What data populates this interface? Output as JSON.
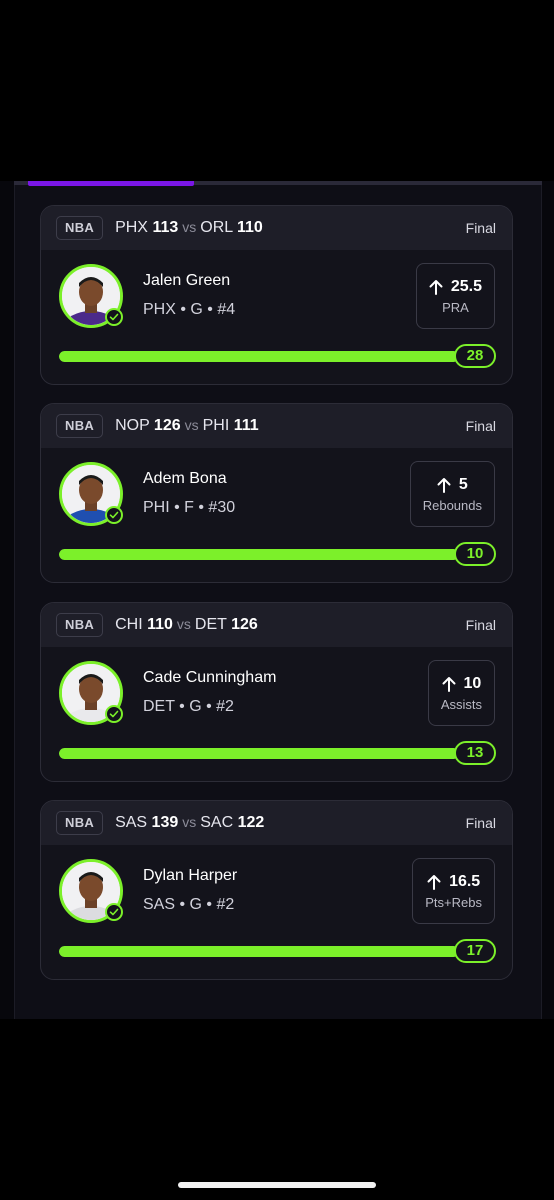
{
  "colors": {
    "accent": "#7cf02a",
    "tab_indicator": "#7a16e6",
    "card_bg": "#13131b",
    "header_bg": "#1e1e28"
  },
  "picks": [
    {
      "league": "NBA",
      "away_team": "PHX",
      "away_score": "113",
      "vs": "vs",
      "home_team": "ORL",
      "home_score": "110",
      "status": "Final",
      "player_name": "Jalen Green",
      "player_meta": "PHX • G • #4",
      "direction": "arrow-up-icon",
      "line_value": "25.5",
      "stat": "PRA",
      "result": "28",
      "progress": 1.0,
      "jersey_color": "#4b2a8a"
    },
    {
      "league": "NBA",
      "away_team": "NOP",
      "away_score": "126",
      "vs": "vs",
      "home_team": "PHI",
      "home_score": "111",
      "status": "Final",
      "player_name": "Adem Bona",
      "player_meta": "PHI • F • #30",
      "direction": "arrow-up-icon",
      "line_value": "5",
      "stat": "Rebounds",
      "result": "10",
      "progress": 1.0,
      "jersey_color": "#1f4fb0"
    },
    {
      "league": "NBA",
      "away_team": "CHI",
      "away_score": "110",
      "vs": "vs",
      "home_team": "DET",
      "home_score": "126",
      "status": "Final",
      "player_name": "Cade Cunningham",
      "player_meta": "DET • G • #2",
      "direction": "arrow-up-icon",
      "line_value": "10",
      "stat": "Assists",
      "result": "13",
      "progress": 1.0,
      "jersey_color": "#e9e9ec"
    },
    {
      "league": "NBA",
      "away_team": "SAS",
      "away_score": "139",
      "vs": "vs",
      "home_team": "SAC",
      "home_score": "122",
      "status": "Final",
      "player_name": "Dylan Harper",
      "player_meta": "SAS • G • #2",
      "direction": "arrow-up-icon",
      "line_value": "16.5",
      "stat": "Pts+Rebs",
      "result": "17",
      "progress": 1.0,
      "jersey_color": "#dcdce0"
    }
  ]
}
